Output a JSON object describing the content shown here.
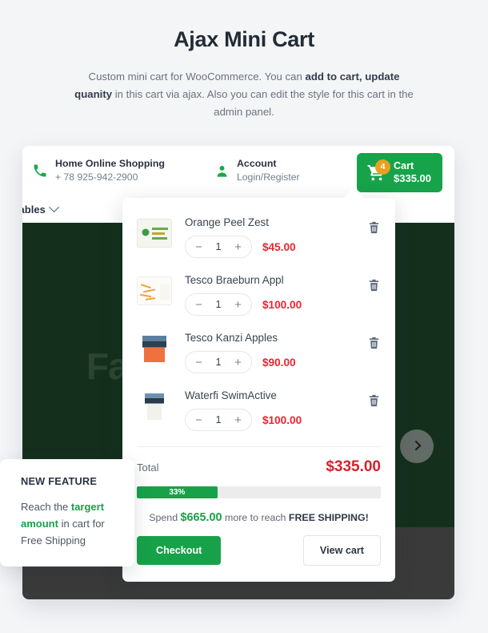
{
  "intro": {
    "title": "Ajax Mini Cart",
    "desc_1": "Custom mini cart for WooCommerce. You can ",
    "desc_bold_1": "add to cart, update quanity",
    "desc_2": " in this cart via ajax. Also you can edit the style for this cart in the admin panel."
  },
  "shop_header": {
    "phone_icon": "phone-icon",
    "shop_name": "Home Online Shopping",
    "phone_number": "+ 78 925-942-2900",
    "account_icon": "user-icon",
    "account_label": "Account",
    "account_sub": "Login/Register",
    "cart_icon": "shopping-cart-icon",
    "cart_badge": "4",
    "cart_label": "Cart",
    "cart_total": "$335.00"
  },
  "nav": {
    "item_label": "etables",
    "chevron_icon": "chevron-down-icon"
  },
  "hero": {
    "word": "Fa",
    "next_icon": "chevron-right-icon"
  },
  "mini_cart": {
    "items": [
      {
        "name": "Orange Peel Zest",
        "qty": "1",
        "price": "$45.00",
        "minus": "−",
        "plus": "+",
        "delete_icon": "trash-icon",
        "thumb": "egg-carton"
      },
      {
        "name": "Tesco Braeburn Appl",
        "qty": "1",
        "price": "$100.00",
        "minus": "−",
        "plus": "+",
        "delete_icon": "trash-icon",
        "thumb": "carrot-tray"
      },
      {
        "name": "Tesco Kanzi Apples",
        "qty": "1",
        "price": "$90.00",
        "minus": "−",
        "plus": "+",
        "delete_icon": "trash-icon",
        "thumb": "salmon-pack"
      },
      {
        "name": "Waterfi SwimActive",
        "qty": "1",
        "price": "$100.00",
        "minus": "−",
        "plus": "+",
        "delete_icon": "trash-icon",
        "thumb": "water-pack"
      }
    ],
    "total_label": "Total",
    "total_value": "$335.00",
    "progress_percent": "33%",
    "progress_value": 33,
    "ship_pre": "Spend ",
    "ship_amount": "$665.00",
    "ship_mid": " more to reach ",
    "ship_bold": "FREE SHIPPING!",
    "checkout_label": "Checkout",
    "viewcart_label": "View cart"
  },
  "callout": {
    "heading": "NEW FEATURE",
    "text_pre": "Reach the ",
    "text_bold": "targert amount",
    "text_post": " in cart for Free Shipping"
  },
  "colors": {
    "green": "#17a249",
    "red": "#e8262f",
    "badge_orange": "#e8a020",
    "hero_dark": "#14301d"
  }
}
